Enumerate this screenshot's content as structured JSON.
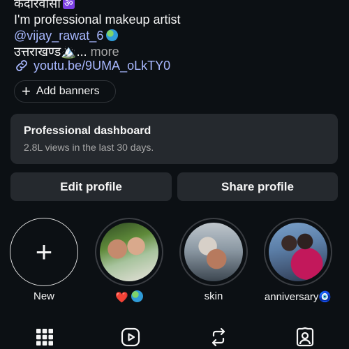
{
  "bio": {
    "line1_text": "कदारवासा",
    "line1_badge": "ॐ",
    "line2": "I'm professional makeup artist",
    "mention": "@vijay_rawat_6",
    "line4_text": "उत्तराखण्ड🏔️...",
    "line4_more": "more",
    "link": "youtu.be/9UMA_oLkTY0"
  },
  "add_banners": {
    "label": "Add banners"
  },
  "dashboard": {
    "title": "Professional dashboard",
    "subtitle": "2.8L views in the last 30 days."
  },
  "actions": {
    "edit_label": "Edit profile",
    "share_label": "Share profile"
  },
  "highlights": {
    "new_label": "New",
    "items": [
      {
        "label": "❤️"
      },
      {
        "label": "skin"
      },
      {
        "label": "anniversary🧿"
      }
    ]
  },
  "tabs": [
    {
      "icon": "grid-icon"
    },
    {
      "icon": "reels-icon"
    },
    {
      "icon": "repost-icon"
    },
    {
      "icon": "tagged-icon"
    }
  ],
  "colors": {
    "background": "#0c1014",
    "card": "#25292e",
    "link": "#a8b8ff",
    "muted": "#a8a8a8"
  }
}
